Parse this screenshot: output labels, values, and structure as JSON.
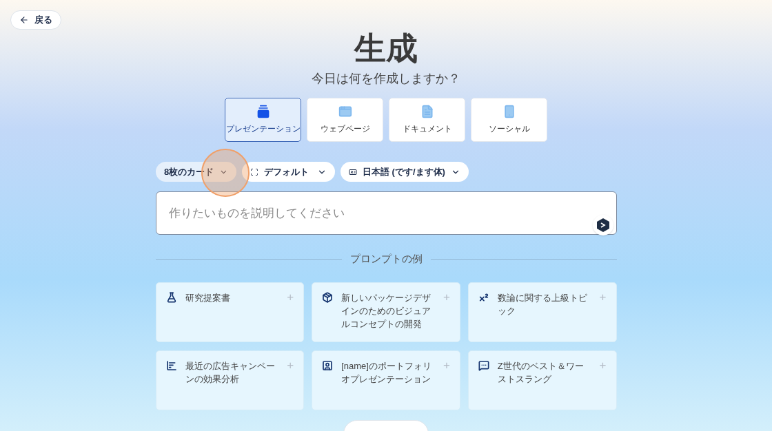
{
  "back_button": {
    "label": "戻る"
  },
  "title": "生成",
  "subtitle": "今日は何を作成しますか？",
  "tabs": [
    {
      "label": "プレゼンテーション",
      "kind": "presentation",
      "selected": true
    },
    {
      "label": "ウェブページ",
      "kind": "webpage",
      "selected": false
    },
    {
      "label": "ドキュメント",
      "kind": "document",
      "selected": false
    },
    {
      "label": "ソーシャル",
      "kind": "social",
      "selected": false
    }
  ],
  "options": [
    {
      "label": "8枚のカード",
      "kind": "cards"
    },
    {
      "label": "デフォルト",
      "kind": "layout"
    },
    {
      "label": "日本語 (です/ます体)",
      "kind": "language"
    }
  ],
  "prompt_field": {
    "placeholder": "作りたいものを説明してください"
  },
  "examples_heading": "プロンプトの例",
  "examples": [
    {
      "text": "研究提案書",
      "kind": "flask"
    },
    {
      "text": "新しいパッケージデザインのためのビジュアルコンセプトの開発",
      "kind": "box"
    },
    {
      "text": "数論に関する上級トピック",
      "kind": "superscript"
    },
    {
      "text": "最近の広告キャンペーンの効果分析",
      "kind": "chart"
    },
    {
      "text": "[name]のポートフォリオプレゼンテーション",
      "kind": "contact"
    },
    {
      "text": "Z世代のベスト＆ワーストスラング",
      "kind": "chat"
    }
  ],
  "add_sign": "+"
}
